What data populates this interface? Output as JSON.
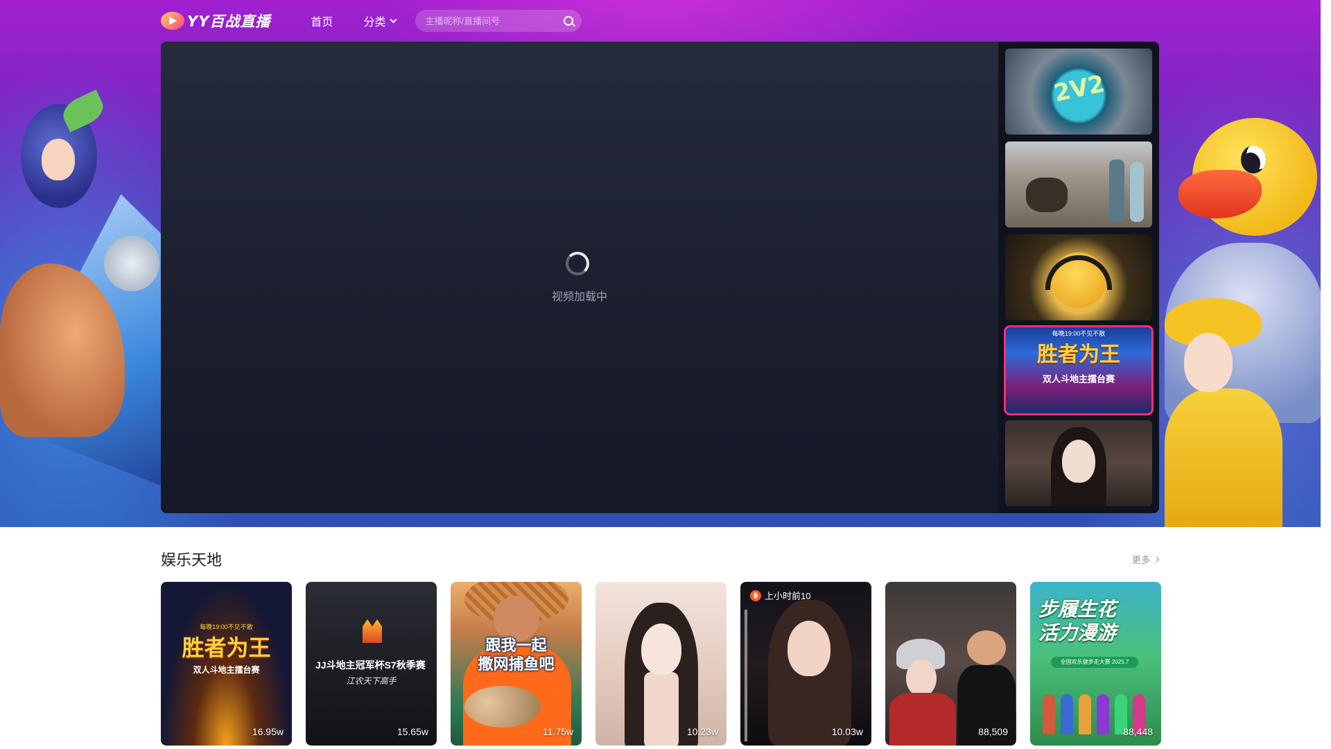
{
  "header": {
    "logo_text": "YY百战直播",
    "nav": {
      "home": "首页",
      "category": "分类"
    },
    "search": {
      "placeholder": "主播昵称/直播间号"
    }
  },
  "player": {
    "loading_text": "视频加载中"
  },
  "rail": {
    "items": [
      {
        "label": "2V2"
      },
      {
        "label": ""
      },
      {
        "label": ""
      },
      {
        "top": "每晚19:00不见不散",
        "title": "胜者为王",
        "sub": "双人斗地主擂台赛",
        "active": true
      },
      {
        "label": ""
      }
    ]
  },
  "section": {
    "title": "娱乐天地",
    "more": "更多",
    "cards": [
      {
        "views": "16.95w",
        "top": "每晚19:00不见不散",
        "title": "胜者为王",
        "sub": "双人斗地主擂台赛"
      },
      {
        "views": "15.65w",
        "title": "JJ斗地主冠军杯S7秋季赛",
        "slogan": "江农天下高手"
      },
      {
        "views": "11.75w",
        "caption": [
          "跟我一起",
          "撒网捕鱼吧"
        ]
      },
      {
        "views": "10.23w"
      },
      {
        "views": "10.03w",
        "badge": "上小时前10"
      },
      {
        "views": "88,509"
      },
      {
        "views": "88,448",
        "caption": [
          "步履生花",
          "活力漫游"
        ],
        "bar": "全国欢乐健步走大赛 2025.7"
      }
    ]
  },
  "colors": {
    "active_outline": "#ff2f6e",
    "hero_top": "#a21fcf",
    "hero_bottom": "#2f4fb5"
  }
}
